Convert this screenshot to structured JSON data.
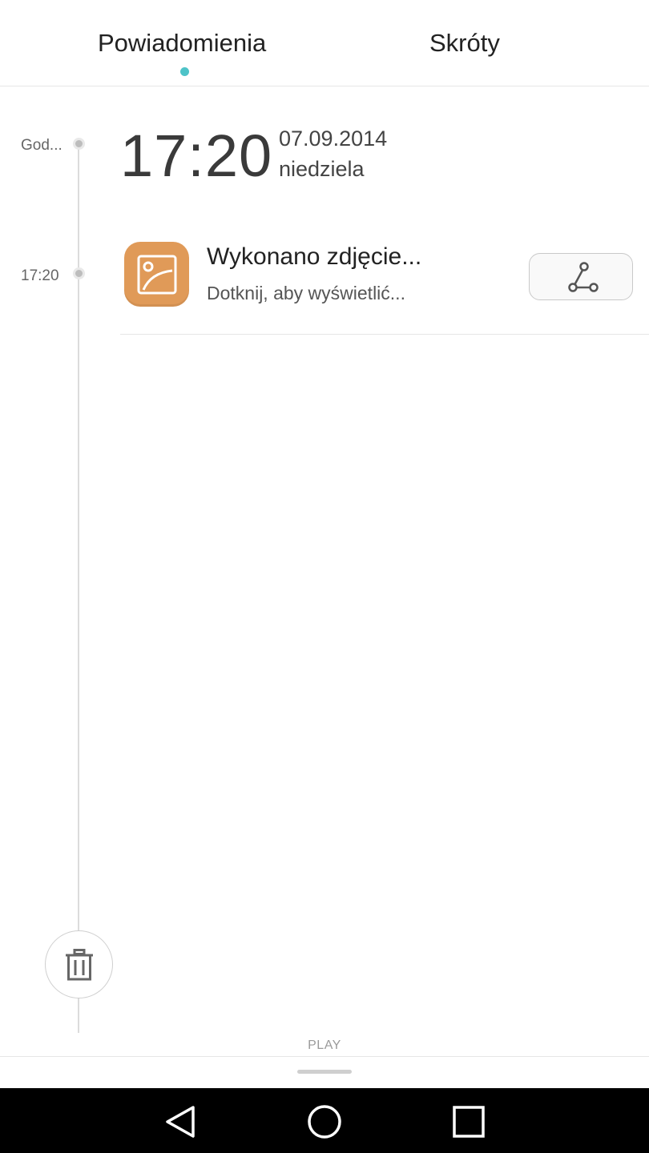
{
  "tabs": {
    "notifications_label": "Powiadomienia",
    "shortcuts_label": "Skróty",
    "active_indicator_color": "#4ec3c8"
  },
  "timeline": {
    "header_label": "God...",
    "entry_time_label": "17:20"
  },
  "clock": {
    "time": "17:20",
    "date": "07.09.2014",
    "weekday": "niedziela"
  },
  "notification": {
    "app_icon": "gallery-icon",
    "app_icon_color": "#e09a58",
    "title": "Wykonano zdjęcie...",
    "subtitle": "Dotknij, aby wyświetlić...",
    "action_icon": "share-icon"
  },
  "actions": {
    "clear_icon": "trash-icon"
  },
  "bottom": {
    "play_label": "PLAY"
  },
  "navbar": {
    "back_icon": "back-icon",
    "home_icon": "home-icon",
    "recents_icon": "recents-icon"
  }
}
